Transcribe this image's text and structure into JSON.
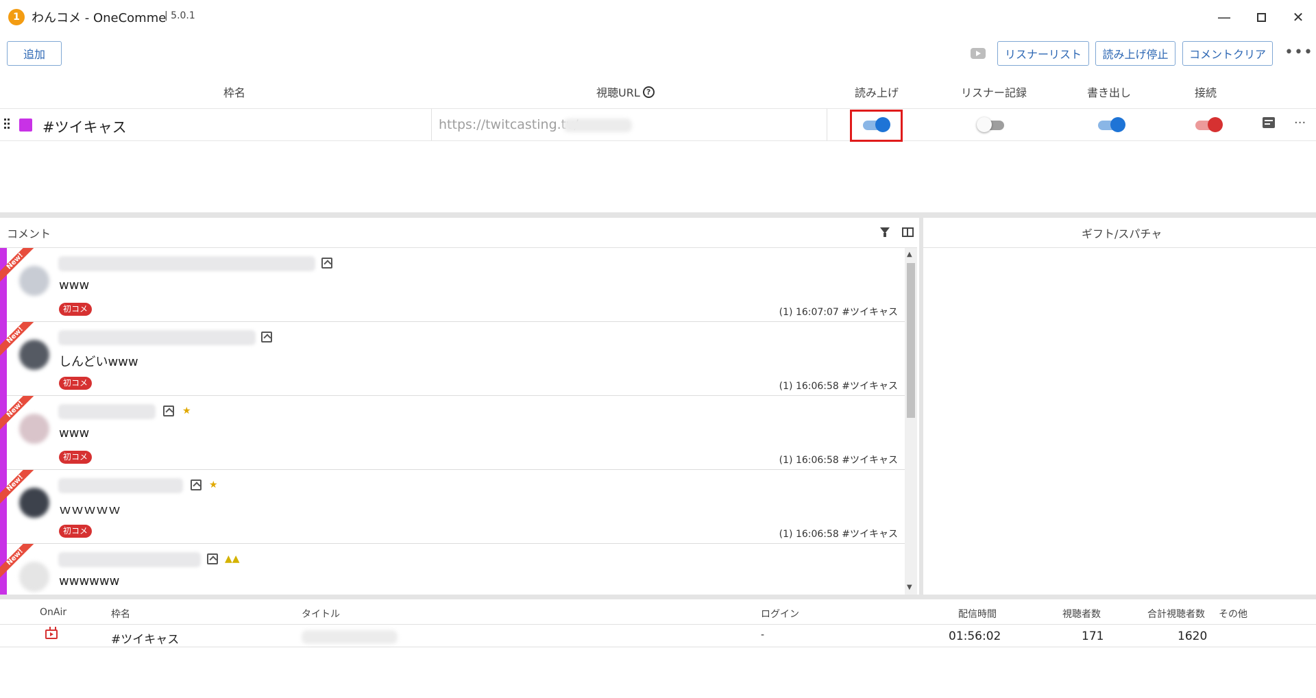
{
  "titlebar": {
    "title": "わんコメ - OneComme",
    "version": "| 5.0.1"
  },
  "toolbar": {
    "add_label": "追加",
    "listener_list_label": "リスナーリスト",
    "stop_reading_label": "読み上げ停止",
    "clear_comments_label": "コメントクリア",
    "more": "•••"
  },
  "frame_table": {
    "headers": {
      "name": "枠名",
      "url": "視聴URL",
      "read_aloud": "読み上げ",
      "listener_record": "リスナー記録",
      "export": "書き出し",
      "connect": "接続"
    },
    "rows": [
      {
        "name": "#ツイキャス",
        "url": "https://twitcasting.tv/",
        "color": "#c832e6",
        "read_aloud": true,
        "listener_record": false,
        "export": true,
        "connect": true
      }
    ]
  },
  "comment_panel": {
    "title": "コメント",
    "comments": [
      {
        "text": "www",
        "tag": "初コメ",
        "meta": "(1) 16:07:07 #ツイキャス",
        "new": "New!"
      },
      {
        "text": "しんどいwww",
        "tag": "初コメ",
        "meta": "(1) 16:06:58 #ツイキャス",
        "new": "New!"
      },
      {
        "text": "www",
        "tag": "初コメ",
        "meta": "(1) 16:06:58 #ツイキャス",
        "new": "New!"
      },
      {
        "text": "ｗｗｗｗｗ",
        "tag": "初コメ",
        "meta": "(1) 16:06:58 #ツイキャス",
        "new": "New!"
      },
      {
        "text": "wwwwww",
        "tag": "",
        "meta": "",
        "new": "New!"
      }
    ]
  },
  "gift_panel": {
    "title": "ギフト/スパチャ"
  },
  "stream_table": {
    "headers": {
      "onair": "OnAir",
      "name": "枠名",
      "title": "タイトル",
      "login": "ログイン",
      "duration": "配信時間",
      "viewers": "視聴者数",
      "total_viewers": "合計視聴者数",
      "other": "その他"
    },
    "rows": [
      {
        "name": "#ツイキャス",
        "login": "-",
        "duration": "01:56:02",
        "viewers": "171",
        "total_viewers": "1620"
      }
    ]
  },
  "colors": {
    "accent": "#2b66b3",
    "toggle_on": "#1e74d6",
    "connect_on": "#d63131",
    "frame_color": "#c832e6"
  },
  "icons": [
    "onecomme-logo-icon",
    "youtube-icon",
    "help-icon",
    "filter-icon",
    "columns-icon",
    "comment-icon",
    "tv-icon"
  ]
}
